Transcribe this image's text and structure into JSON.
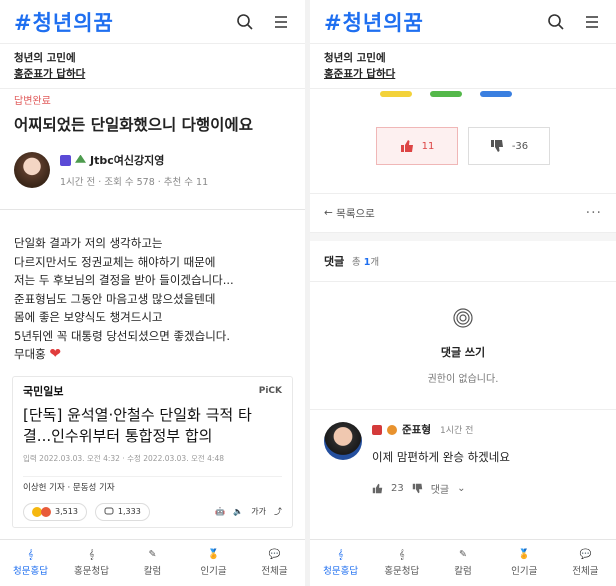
{
  "app": {
    "logo": "#청년의꿈"
  },
  "sub_header": {
    "line1": "청년의 고민에",
    "line2": "홍준표가 답하다"
  },
  "post": {
    "status": "답변완료",
    "title": "어찌되었든 단일화했으니 다행이에요",
    "author": "Jtbc여신강지영",
    "meta": "1시간 전  ·  조회 수 578  ·  추천 수 11",
    "body": [
      "단일화 결과가 저의 생각하고는",
      "다르지만서도 정권교체는 해야하기 때문에",
      "저는 두 후보님의 결정을 받아 들이겠습니다...",
      "준표형님도 그동안 마음고생 많으셨을텐데",
      "몸에 좋은 보양식도 챙겨드시고",
      "5년뒤엔 꼭 대통령 당선되셨으면 좋겠습니다.",
      "무대홍"
    ],
    "heart": "❤"
  },
  "news": {
    "publisher": "국민일보",
    "pick": "PiCK",
    "headline1": "[단독] 윤석열·안철수 단일화 극적 타",
    "headline2": "결...인수위부터 통합정부 합의",
    "date": "입력 2022.03.03. 오전 4:32 · 수정 2022.03.03. 오전 4:48",
    "reporters": "이상헌 기자 · 문동성 기자",
    "reactions": "3,513",
    "comments": "1,333",
    "font_label": "가가"
  },
  "nav": {
    "items": [
      {
        "label": "청문홍답",
        "icon": "ear-icon"
      },
      {
        "label": "홍문청답",
        "icon": "ear-icon"
      },
      {
        "label": "칼럼",
        "icon": "pen-icon"
      },
      {
        "label": "인기글",
        "icon": "medal-icon"
      },
      {
        "label": "전체글",
        "icon": "chat-icon"
      }
    ]
  },
  "colors": {
    "accent": "#1f6ff0",
    "status": "#e05a5a",
    "bar_yellow": "#f3d23a",
    "bar_green": "#54b84a",
    "bar_blue": "#3a7fe0"
  },
  "vote": {
    "up": "11",
    "down": "-36"
  },
  "list_link": "목록으로",
  "comments_section": {
    "title": "댓글",
    "count_prefix": "총",
    "count": "1",
    "count_suffix": "개",
    "write_title": "댓글 쓰기",
    "write_sub": "권한이 없습니다."
  },
  "comment": {
    "author": "준표형",
    "time": "1시간 전",
    "text": "이제 맘편하게 완승 하겠네요",
    "likes": "23",
    "reply": "댓글"
  }
}
